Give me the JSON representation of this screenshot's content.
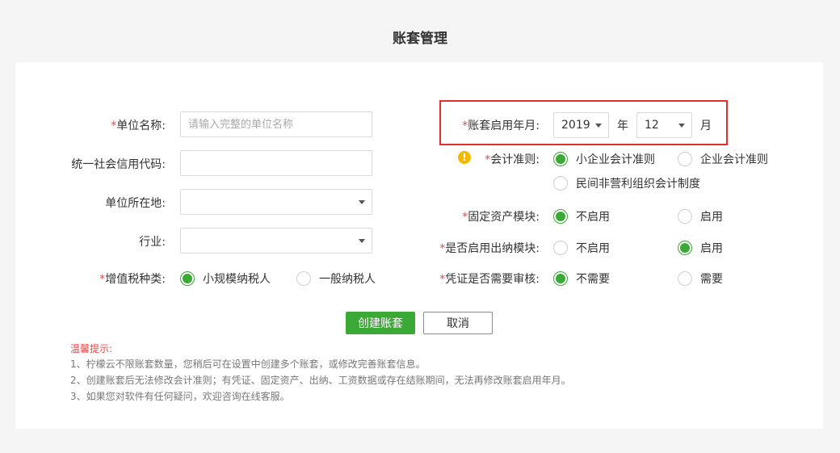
{
  "title": "账套管理",
  "left": {
    "unit_name": {
      "label": "单位名称:",
      "required": "*",
      "placeholder": "请输入完整的单位名称",
      "value": ""
    },
    "credit_code": {
      "label": "统一社会信用代码:",
      "value": ""
    },
    "location": {
      "label": "单位所在地:",
      "value": ""
    },
    "industry": {
      "label": "行业:",
      "value": ""
    },
    "vat_type": {
      "label": "增值税种类:",
      "required": "*",
      "options": [
        "小规模纳税人",
        "一般纳税人"
      ],
      "selected": "小规模纳税人"
    }
  },
  "right": {
    "start_period": {
      "label": "账套启用年月:",
      "required": "*",
      "year": "2019",
      "year_unit": "年",
      "month": "12",
      "month_unit": "月"
    },
    "accounting_standard": {
      "label": "会计准则:",
      "required": "*",
      "warning_icon": "!",
      "options": [
        "小企业会计准则",
        "企业会计准则",
        "民间非营利组织会计制度"
      ],
      "selected": "小企业会计准则"
    },
    "fixed_assets": {
      "label": "固定资产模块:",
      "required": "*",
      "options": [
        "不启用",
        "启用"
      ],
      "selected": "不启用"
    },
    "cashier": {
      "label": "是否启用出纳模块:",
      "required": "*",
      "options": [
        "不启用",
        "启用"
      ],
      "selected": "启用"
    },
    "voucher_review": {
      "label": "凭证是否需要审核:",
      "required": "*",
      "options": [
        "不需要",
        "需要"
      ],
      "selected": "不需要"
    }
  },
  "actions": {
    "create": "创建账套",
    "cancel": "取消"
  },
  "tips": {
    "title": "温馨提示:",
    "items": [
      "1、柠檬云不限账套数量，您稍后可在设置中创建多个账套，或修改完善账套信息。",
      "2、创建账套后无法修改会计准则；有凭证、固定资产、出纳、工资数据或存在结账期间，无法再修改账套启用年月。",
      "3、如果您对软件有任何疑问，欢迎咨询在线客服。"
    ]
  },
  "colors": {
    "accent": "#3aa935",
    "required": "#e04b4b",
    "highlight": "#e0302a",
    "warning": "#f5b800"
  }
}
